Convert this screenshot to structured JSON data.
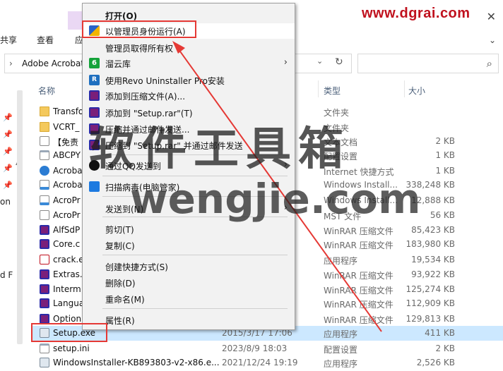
{
  "ribbon": {
    "tabs": [
      "共享",
      "查看",
      "应"
    ],
    "brand_logo": "www.dgrai.com"
  },
  "address": {
    "path": "Adobe Acrobat"
  },
  "nav": {
    "labels": [
      "on",
      "d F"
    ]
  },
  "columns": {
    "name": "名称",
    "type": "类型",
    "size": "大小"
  },
  "files": [
    {
      "name": "Transfo",
      "date": "",
      "type": "文件夹",
      "size": "",
      "icon": "folder-icon"
    },
    {
      "name": "VCRT_",
      "date": "",
      "type": "文件夹",
      "size": "",
      "icon": "folder-icon"
    },
    {
      "name": "【免责",
      "date": "",
      "type": "文本文档",
      "size": "2 KB",
      "icon": "text-file-icon"
    },
    {
      "name": "ABCPY",
      "date": "",
      "type": "配置设置",
      "size": "1 KB",
      "icon": "config-file-icon"
    },
    {
      "name": "Acroba",
      "date": "",
      "type": "Internet 快捷方式",
      "size": "1 KB",
      "icon": "internet-shortcut-icon"
    },
    {
      "name": "Acroba",
      "date": "",
      "type": "Windows Install...",
      "size": "338,248 KB",
      "icon": "msi-file-icon"
    },
    {
      "name": "AcroPr",
      "date": "",
      "type": "Windows Install...",
      "size": "12,888 KB",
      "icon": "msi-file-icon"
    },
    {
      "name": "AcroPr",
      "date": "",
      "type": "MST 文件",
      "size": "56 KB",
      "icon": "mst-file-icon"
    },
    {
      "name": "AlfSdP",
      "date": "",
      "type": "WinRAR 压缩文件",
      "size": "85,423 KB",
      "icon": "winrar-icon"
    },
    {
      "name": "Core.c",
      "date": "",
      "type": "WinRAR 压缩文件",
      "size": "183,980 KB",
      "icon": "winrar-icon"
    },
    {
      "name": "crack.e",
      "date": "",
      "type": "应用程序",
      "size": "19,534 KB",
      "icon": "acrobat-icon"
    },
    {
      "name": "Extras.",
      "date": "",
      "type": "WinRAR 压缩文件",
      "size": "93,922 KB",
      "icon": "winrar-icon"
    },
    {
      "name": "Interm",
      "date": "",
      "type": "WinRAR 压缩文件",
      "size": "125,274 KB",
      "icon": "winrar-icon"
    },
    {
      "name": "Langua",
      "date": "",
      "type": "WinRAR 压缩文件",
      "size": "112,909 KB",
      "icon": "winrar-icon"
    },
    {
      "name": "Option",
      "date": "",
      "type": "WinRAR 压缩文件",
      "size": "129,813 KB",
      "icon": "winrar-icon"
    },
    {
      "name": "Setup.exe",
      "date": "2015/3/17 17:06",
      "type": "应用程序",
      "size": "411 KB",
      "icon": "setup-exe-icon",
      "selected": true
    },
    {
      "name": "setup.ini",
      "date": "2023/8/9 18:03",
      "type": "配置设置",
      "size": "2 KB",
      "icon": "config-file-icon"
    },
    {
      "name": "WindowsInstaller-KB893803-v2-x86.e...",
      "date": "2021/12/24 19:19",
      "type": "应用程序",
      "size": "2,526 KB",
      "icon": "setup-exe-icon"
    }
  ],
  "context_menu": {
    "items": [
      {
        "label": "打开(O)",
        "icon": "",
        "submenu": false,
        "bold": true
      },
      {
        "label": "以管理员身份运行(A)",
        "icon": "uac-shield-icon",
        "submenu": false,
        "highlighted": true
      },
      {
        "label": "管理员取得所有权",
        "icon": "",
        "submenu": false
      },
      {
        "label": "溜云库",
        "icon": "liuyunku-icon",
        "submenu": true
      },
      {
        "label": "使用Revo Uninstaller Pro安装",
        "icon": "revo-uninstaller-icon",
        "submenu": false
      },
      {
        "label": "添加到压缩文件(A)...",
        "icon": "winrar-icon",
        "submenu": false
      },
      {
        "label": "添加到 \"Setup.rar\"(T)",
        "icon": "winrar-icon",
        "submenu": false
      },
      {
        "label": "压缩并通过邮件发送...",
        "icon": "winrar-icon",
        "submenu": false
      },
      {
        "label": "压缩到 \"Setup.rar\" 并通过邮件发送",
        "icon": "winrar-icon",
        "submenu": false
      },
      {
        "label": "通过QQ发送到",
        "icon": "qq-icon",
        "submenu": true
      },
      {
        "label": "扫描病毒(电脑管家)",
        "icon": "pc-manager-shield-icon",
        "submenu": false
      },
      {
        "label": "发送到(N)",
        "icon": "",
        "submenu": true
      },
      {
        "label": "剪切(T)",
        "icon": "",
        "submenu": false
      },
      {
        "label": "复制(C)",
        "icon": "",
        "submenu": false
      },
      {
        "label": "创建快捷方式(S)",
        "icon": "",
        "submenu": false
      },
      {
        "label": "删除(D)",
        "icon": "",
        "submenu": false
      },
      {
        "label": "重命名(M)",
        "icon": "",
        "submenu": false
      },
      {
        "label": "属性(R)",
        "icon": "",
        "submenu": false
      }
    ]
  },
  "watermark": {
    "chinese": "软件工具箱",
    "english": "wengjie.com"
  },
  "colors": {
    "annotation_red": "#e53935",
    "selection_blue": "#cce8ff",
    "menu_bg": "#f2f2f2",
    "brand_red": "#c0111e"
  }
}
